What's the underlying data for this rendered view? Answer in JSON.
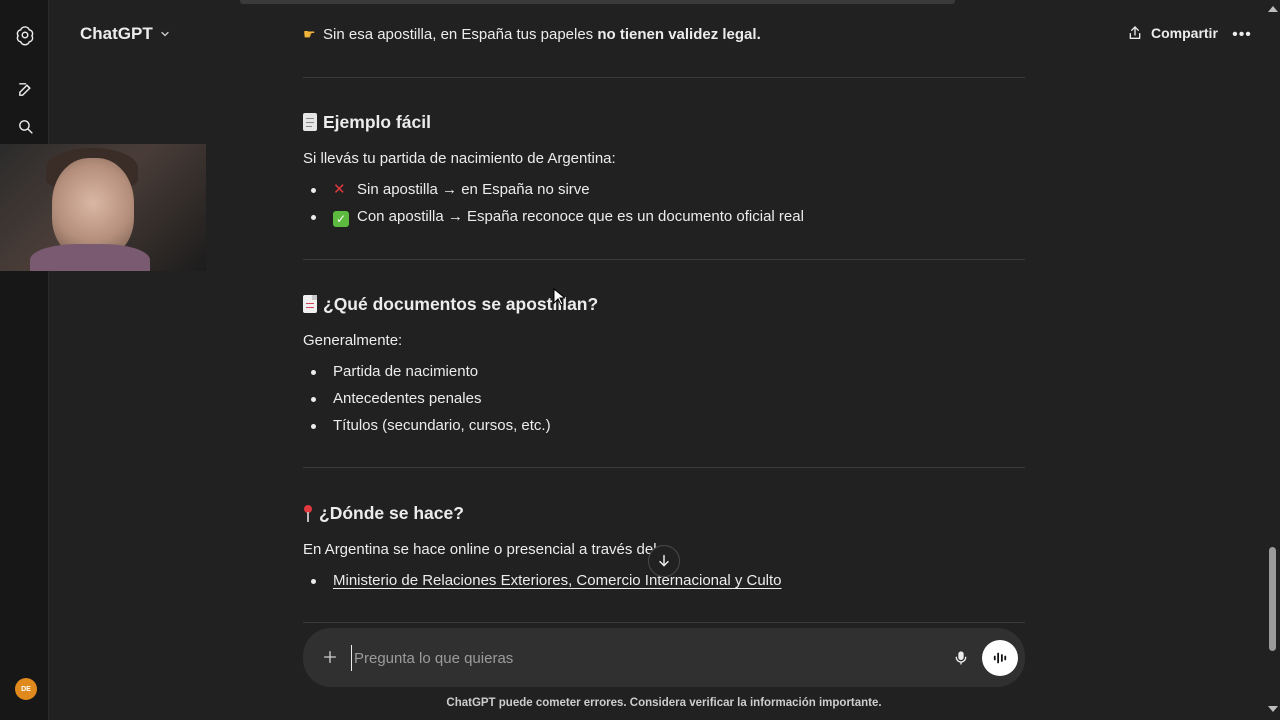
{
  "header": {
    "model_label": "ChatGPT",
    "share_label": "Compartir"
  },
  "sidebar": {
    "avatar_initials": "DE"
  },
  "content": {
    "intro_line": {
      "pre": "Sin esa apostilla, en España tus papeles ",
      "bold": "no tienen validez legal."
    },
    "section_example": {
      "title": "Ejemplo fácil",
      "lead": "Si llevás tu partida de nacimiento de Argentina:",
      "items": [
        "Sin apostilla → en España no sirve",
        "Con apostilla → España reconoce que es un documento oficial real"
      ]
    },
    "section_docs": {
      "title": "¿Qué documentos se apostillan?",
      "lead": "Generalmente:",
      "items": [
        "Partida de nacimiento",
        "Antecedentes penales",
        "Títulos (secundario, cursos, etc.)"
      ]
    },
    "section_where": {
      "title": "¿Dónde se hace?",
      "lead": "En Argentina se hace online o presencial a través del:",
      "items": [
        "Ministerio de Relaciones Exteriores, Comercio Internacional y Culto"
      ]
    }
  },
  "composer": {
    "placeholder": "Pregunta lo que quieras"
  },
  "footer": {
    "disclaimer": "ChatGPT puede cometer errores. Considera verificar la información importante."
  },
  "colors": {
    "background": "#212121",
    "sidebar": "#171717",
    "composer": "#303030",
    "text": "#ececec",
    "avatar": "#e08a1e"
  }
}
